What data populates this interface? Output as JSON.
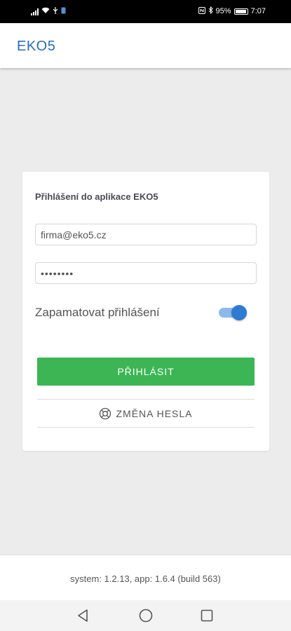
{
  "status_bar": {
    "battery_percent": "95%",
    "time": "7:07"
  },
  "app_bar": {
    "title": "EKO5"
  },
  "login": {
    "title": "Přihlášení do aplikace EKO5",
    "email_value": "firma@eko5.cz",
    "password_value": "••••••••",
    "remember_label": "Zapamatovat přihlášení",
    "remember_on": true,
    "submit_label": "PŘIHLÁSIT",
    "change_password_label": "ZMĚNA HESLA"
  },
  "footer": {
    "version": "system: 1.2.13, app: 1.6.4 (build 563)"
  },
  "colors": {
    "brand_blue": "#2a6db5",
    "accent_green": "#3cb554",
    "toggle_blue": "#2f7ad3"
  },
  "icons": {
    "change_password": "lifebuoy-icon",
    "nav_back": "triangle-back-icon",
    "nav_home": "circle-home-icon",
    "nav_recent": "square-recent-icon"
  }
}
